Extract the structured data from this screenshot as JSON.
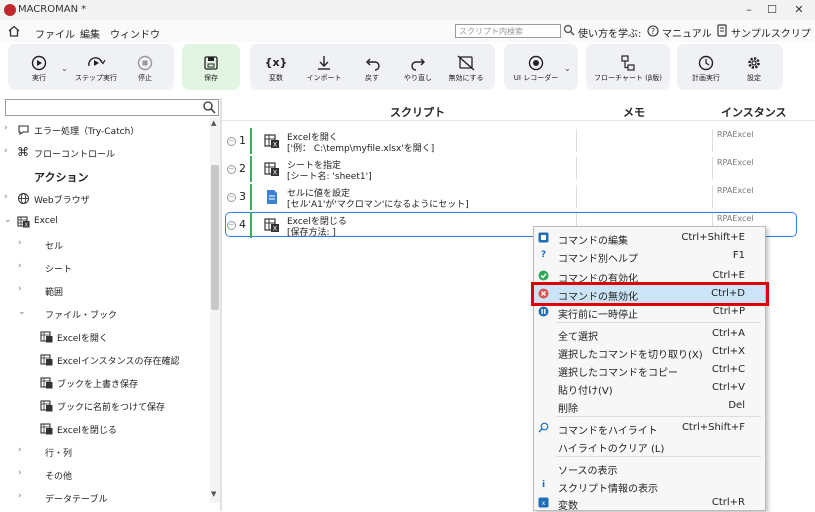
{
  "window": {
    "title": "MACROMAN *",
    "minimize": "–",
    "maximize": "☐",
    "close": "✕"
  },
  "menubar": {
    "items": [
      "ファイル",
      "編集",
      "ウィンドウ"
    ],
    "search_placeholder": "スクリプト内検索",
    "learn": "使い方を学ぶ:",
    "manual": "マニュアル",
    "samples": "サンプルスクリプト"
  },
  "toolbar": {
    "run": "実行",
    "step": "ステップ実行",
    "stop": "停止",
    "save": "保存",
    "variable": "変数",
    "import": "インポート",
    "undo": "戻す",
    "redo": "やり直し",
    "disable": "無効にする",
    "ui_recorder": "UI レコーダー",
    "flowchart": "フローチャート (β版)",
    "schedule": "計画実行",
    "settings": "設定",
    "variable_icon_text": "{x}"
  },
  "tree": {
    "error": "エラー処理（Try-Catch）",
    "flow": "フローコントロール",
    "actions_title": "アクション",
    "browser": "Webブラウザ",
    "excel": "Excel",
    "cell": "セル",
    "sheet": "シート",
    "range": "範囲",
    "file_book": "ファイル・ブック",
    "open": "Excelを開く",
    "instance_check": "Excelインスタンスの存在確認",
    "overwrite": "ブックを上書き保存",
    "save_as": "ブックに名前をつけて保存",
    "close": "Excelを閉じる",
    "rowcol": "行・列",
    "other": "その他",
    "datatable": "データテーブル"
  },
  "columns": {
    "script": "スクリプト",
    "memo": "メモ",
    "instance": "インスタンス"
  },
  "rows": [
    {
      "num": "1",
      "title": "Excelを開く",
      "detail": "['例： C:\\temp\\myfile.xlsx'を開く]",
      "instance": "RPAExcel"
    },
    {
      "num": "2",
      "title": "シートを指定",
      "detail": "[シート名: 'sheet1']",
      "instance": "RPAExcel"
    },
    {
      "num": "3",
      "title": "セルに値を設定",
      "detail": "[セル'A1'が'マクロマン'になるようにセット]",
      "instance": "RPAExcel"
    },
    {
      "num": "4",
      "title": "Excelを閉じる",
      "detail": "[保存方法: ]",
      "instance": "RPAExcel"
    }
  ],
  "context_menu": [
    {
      "label": "コマンドの編集",
      "shortcut": "Ctrl+Shift+E"
    },
    {
      "label": "コマンド別ヘルプ",
      "shortcut": "F1"
    },
    {
      "label": "コマンドの有効化",
      "shortcut": "Ctrl+E"
    },
    {
      "label": "コマンドの無効化",
      "shortcut": "Ctrl+D"
    },
    {
      "label": "実行前に一時停止",
      "shortcut": "Ctrl+P"
    },
    {
      "label": "全て選択",
      "shortcut": "Ctrl+A"
    },
    {
      "label": "選択したコマンドを切り取り(X)",
      "shortcut": "Ctrl+X"
    },
    {
      "label": "選択したコマンドをコピー",
      "shortcut": "Ctrl+C"
    },
    {
      "label": "貼り付け(V)",
      "shortcut": "Ctrl+V"
    },
    {
      "label": "削除",
      "shortcut": "Del"
    },
    {
      "label": "コマンドをハイライト",
      "shortcut": "Ctrl+Shift+F"
    },
    {
      "label": "ハイライトのクリア (L)",
      "shortcut": ""
    },
    {
      "label": "ソースの表示",
      "shortcut": ""
    },
    {
      "label": "スクリプト情報の表示",
      "shortcut": ""
    },
    {
      "label": "変数",
      "shortcut": "Ctrl+R"
    }
  ],
  "colors": {
    "accent": "#3b7ddd",
    "highlight_border": "#e00000",
    "enabled_bar": "#38b15a",
    "save_bg": "#e2f5e2"
  }
}
